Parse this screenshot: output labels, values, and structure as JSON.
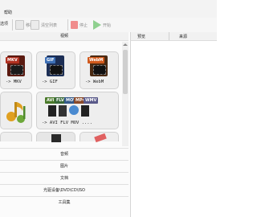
{
  "menu": {
    "help": "帮助"
  },
  "toolbar": {
    "left_label": "选项",
    "remove": "移除",
    "clear_list": "清空列表",
    "stop": "停止",
    "start": "开始"
  },
  "left_panel": {
    "header": "视频"
  },
  "tiles": [
    {
      "label": "-> MKV",
      "badge": "MKV"
    },
    {
      "label": "-> GIF",
      "badge": "GIF"
    },
    {
      "label": "-> WebM",
      "badge": "WebM"
    },
    {
      "label": "",
      "badge": ""
    },
    {
      "label": "-> AVI FLV MOV ....",
      "badges": [
        "AVI",
        "FLV",
        "MOV",
        "MP4",
        "WMV"
      ]
    }
  ],
  "accordion": [
    "音频",
    "图片",
    "文档",
    "光驱设备\\DVD\\CD\\ISO",
    "工具集"
  ],
  "right_panel": {
    "col_source": "预览",
    "col_state": "来源"
  },
  "colors": {
    "mkv": "#b03020",
    "gif": "#3d6fb5",
    "webm": "#d15a1d",
    "music_note": "#e0a020",
    "music_green": "#6da83a",
    "stop": "#e65050",
    "start": "#5cb85c"
  }
}
